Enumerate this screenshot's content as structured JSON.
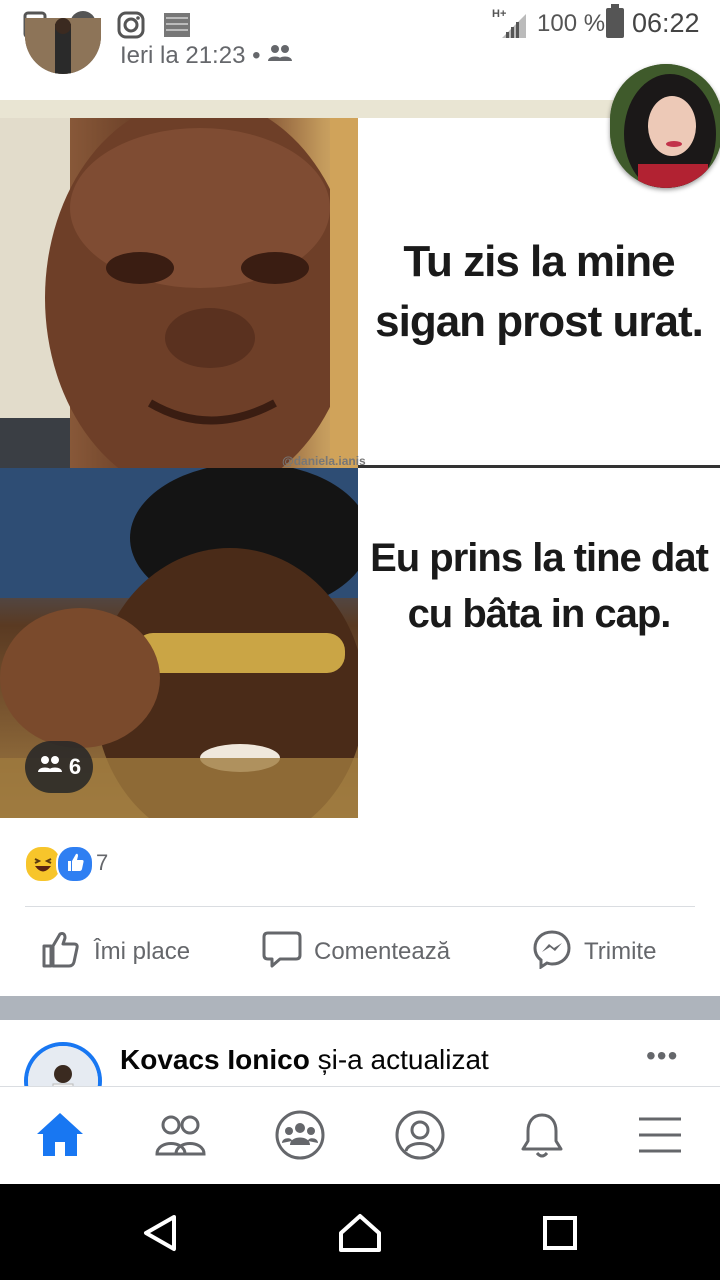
{
  "status_bar": {
    "network": "H+",
    "battery_percent": "100 %",
    "time": "06:22",
    "icons": [
      "upload-icon",
      "messenger-icon",
      "instagram-icon",
      "gallery-icon",
      "signal-icon",
      "battery-icon"
    ]
  },
  "post": {
    "timestamp": "Ieri la 21:23",
    "separator": "•",
    "audience_icon": "friends-icon",
    "meme": {
      "top_text": "Tu zis la mine sigan prost urat.",
      "bottom_text": "Eu prins la tine dat cu bâta in cap.",
      "watermark": "@daniela.ianis"
    },
    "tagged_count": "6",
    "reactions": {
      "types": [
        "haha",
        "like"
      ],
      "count": "7"
    },
    "actions": {
      "like": "Îmi place",
      "comment": "Comentează",
      "share": "Trimite"
    }
  },
  "next_post": {
    "author": "Kovacs Ionico",
    "action": " și-a actualizat",
    "menu": "•••"
  },
  "bottom_nav": {
    "items": [
      "home-icon",
      "friends-icon",
      "groups-icon",
      "profile-icon",
      "notifications-icon",
      "menu-icon"
    ],
    "active": "home-icon"
  },
  "colors": {
    "accent": "#1877f2",
    "secondary_text": "#65676b",
    "divider": "#dadde1"
  }
}
